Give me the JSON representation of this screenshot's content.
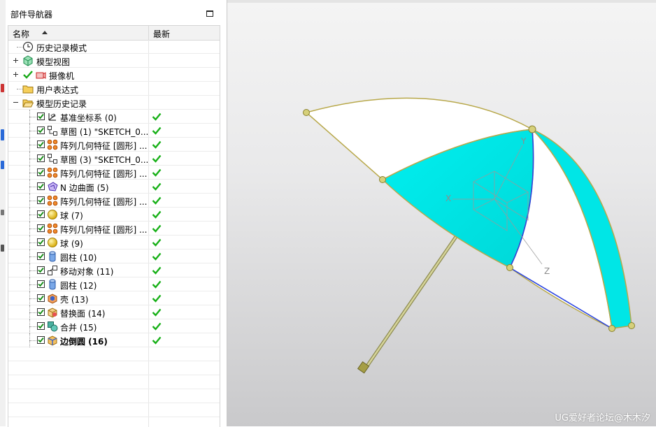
{
  "navigator": {
    "title": "部件导航器",
    "columns": {
      "name": "名称",
      "latest": "最新"
    },
    "top_items": [
      {
        "label": "历史记录模式",
        "icon": "clock-icon"
      },
      {
        "label": "模型视图",
        "icon": "model-view-icon"
      },
      {
        "label": "摄像机",
        "icon": "camera-icon"
      },
      {
        "label": "用户表达式",
        "icon": "folder-icon"
      },
      {
        "label": "模型历史记录",
        "icon": "folder-open-icon"
      }
    ],
    "features": [
      {
        "label": "基准坐标系 (0)",
        "icon": "datum-csys-icon"
      },
      {
        "label": "草图 (1) \"SKETCH_0...",
        "icon": "sketch-icon"
      },
      {
        "label": "阵列几何特征 [圆形] ...",
        "icon": "pattern-icon"
      },
      {
        "label": "草图 (3) \"SKETCH_0...",
        "icon": "sketch-icon"
      },
      {
        "label": "阵列几何特征 [圆形] ...",
        "icon": "pattern-icon"
      },
      {
        "label": "N 边曲面 (5)",
        "icon": "n-sided-surface-icon"
      },
      {
        "label": "阵列几何特征 [圆形] ...",
        "icon": "pattern-icon"
      },
      {
        "label": "球 (7)",
        "icon": "sphere-icon"
      },
      {
        "label": "阵列几何特征 [圆形] ...",
        "icon": "pattern-icon"
      },
      {
        "label": "球 (9)",
        "icon": "sphere-icon"
      },
      {
        "label": "圆柱 (10)",
        "icon": "cylinder-icon"
      },
      {
        "label": "移动对象 (11)",
        "icon": "move-object-icon"
      },
      {
        "label": "圆柱 (12)",
        "icon": "cylinder-icon"
      },
      {
        "label": "壳 (13)",
        "icon": "shell-icon"
      },
      {
        "label": "替换面 (14)",
        "icon": "replace-face-icon"
      },
      {
        "label": "合并 (15)",
        "icon": "unite-icon"
      },
      {
        "label": "边倒圆 (16)",
        "icon": "edge-blend-icon"
      }
    ]
  },
  "viewport": {
    "axis_labels": {
      "x": "X",
      "y": "Y",
      "z": "Z"
    },
    "watermark": "UG爱好者论坛@木木汐",
    "model": "umbrella",
    "colors": {
      "canopy_cyan": "#00e6e6",
      "canopy_white": "#ffffff",
      "edge_gold": "#b8a84a",
      "handle": "#c9c68a"
    }
  }
}
